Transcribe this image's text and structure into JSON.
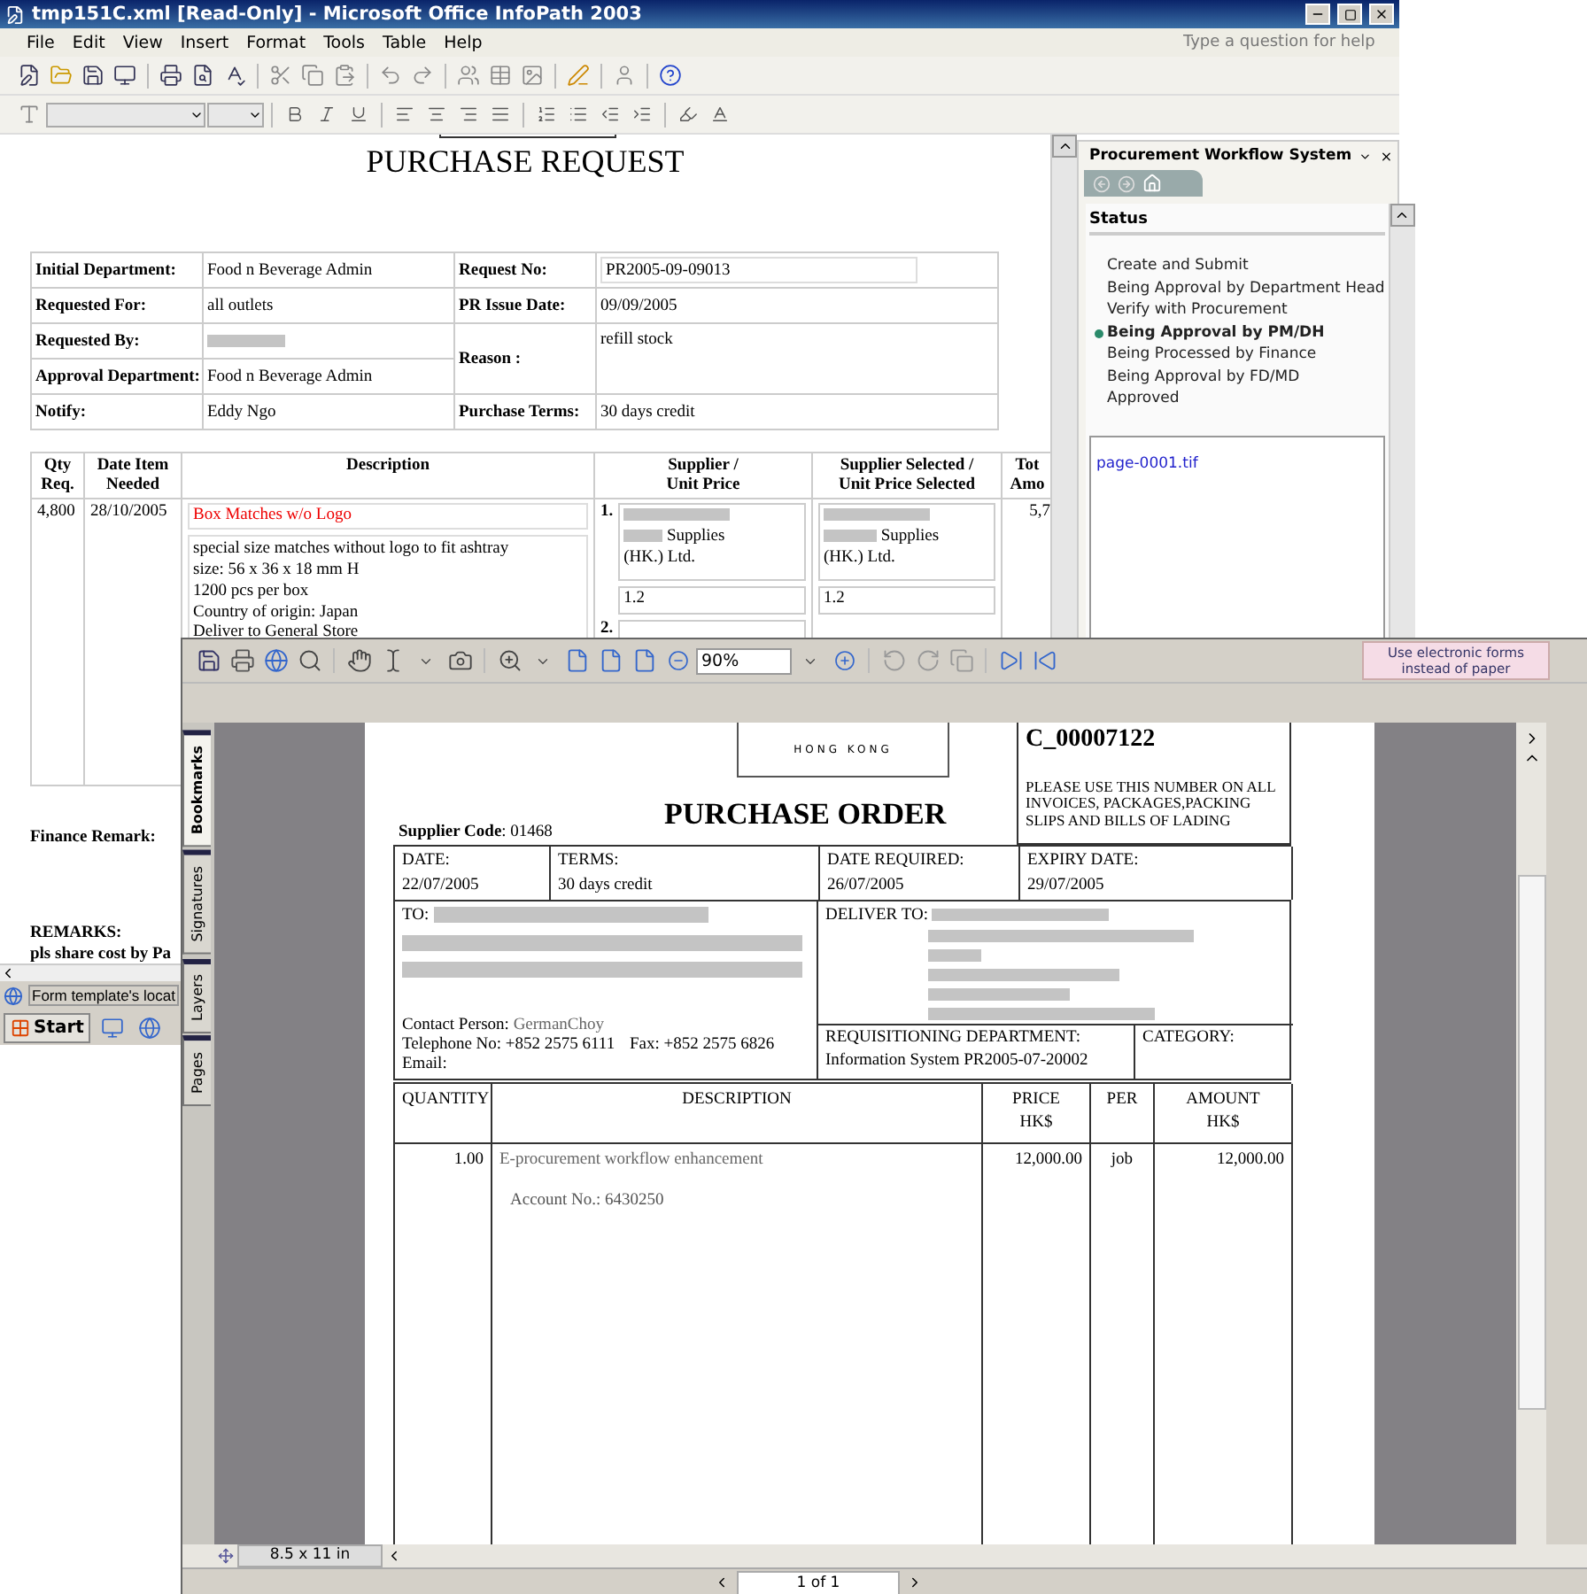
{
  "infopath": {
    "title": "tmp151C.xml [Read-Only] - Microsoft Office InfoPath 2003",
    "menu": [
      "File",
      "Edit",
      "View",
      "Insert",
      "Format",
      "Tools",
      "Table",
      "Help"
    ],
    "help_placeholder": "Type a question for help",
    "form": {
      "title": "PURCHASE REQUEST",
      "left_fields": [
        {
          "label": "Initial Department:",
          "value": "Food n Beverage Admin",
          "redacted": false
        },
        {
          "label": "Requested For:",
          "value": "all outlets",
          "redacted": false
        },
        {
          "label": "Requested By:",
          "redacted": true
        },
        {
          "label": "Approval Department:",
          "value": "Food n Beverage Admin",
          "redacted": false
        },
        {
          "label": "Notify:",
          "value": "Eddy Ngo",
          "redacted": false
        }
      ],
      "right_fields": [
        {
          "kind": "boxed",
          "label": "Request No:",
          "value": "PR2005-09-09013"
        },
        {
          "kind": "plain",
          "label": "PR Issue Date:",
          "value": "09/09/2005"
        },
        {
          "kind": "tall",
          "label": "Reason :",
          "value": "refill stock"
        },
        {
          "kind": "plain",
          "label": "Purchase Terms:",
          "value": "30 days credit"
        }
      ],
      "items_columns": [
        "Qty\nReq.",
        "Date Item\nNeeded",
        "Description",
        "Supplier  /\nUnit Price",
        "Supplier Selected /\nUnit Price Selected",
        "Tot\nAmo"
      ],
      "item": {
        "qty": "4,800",
        "date": "28/10/2005",
        "name": "Box Matches w/o Logo",
        "details": [
          "special size matches without logo to fit ashtray",
          "size: 56 x 36 x 18 mm H",
          "1200 pcs per box",
          "Country of origin: Japan",
          "Deliver to General Store"
        ],
        "suppliers": [
          {
            "number": "1.",
            "name_lines": [
              "Supplies",
              "(HK.) Ltd."
            ],
            "price": "1.2"
          },
          {
            "number": "2."
          }
        ],
        "selected": {
          "name_lines": [
            "Supplies",
            "(HK.) Ltd."
          ],
          "price": "1.2"
        },
        "total": "5,7"
      },
      "finance_remark_label": "Finance Remark:",
      "remarks_label": "REMARKS:",
      "remarks_text": "pls share cost by Pa"
    },
    "task_pane": {
      "title": "Procurement Workflow System",
      "section": "Status",
      "steps": [
        {
          "label": "Create and Submit",
          "selected": false
        },
        {
          "label": "Being Approval by Department Head",
          "selected": false
        },
        {
          "label": "Verify with Procurement",
          "selected": false
        },
        {
          "label": "Being Approval by PM/DH",
          "selected": true
        },
        {
          "label": "Being Processed by Finance",
          "selected": false
        },
        {
          "label": "Being Approval by FD/MD",
          "selected": false
        },
        {
          "label": "Approved",
          "selected": false
        }
      ],
      "attachment": "page-0001.tif"
    },
    "status_text": "Form template's locat"
  },
  "taskbar": {
    "start": "Start"
  },
  "viewer": {
    "zoom": "90%",
    "promo": "Use electronic forms instead of paper",
    "side_tabs": [
      {
        "label": "Bookmarks",
        "selected": true
      },
      {
        "label": "Signatures",
        "selected": false
      },
      {
        "label": "Layers",
        "selected": false
      },
      {
        "label": "Pages",
        "selected": false
      }
    ],
    "document": {
      "logo_text": "HONG KONG",
      "po_number": "C_00007122",
      "notice": "PLEASE USE THIS NUMBER ON ALL INVOICES, PACKAGES,PACKING SLIPS AND BILLS OF LADING",
      "title": "PURCHASE ORDER",
      "supplier_code": "**Supplier Code**: 01468",
      "terms": [
        {
          "label": "DATE:",
          "value": "22/07/2005"
        },
        {
          "label": "TERMS:",
          "value": "30 days credit"
        },
        {
          "label": "DATE REQUIRED:",
          "value": "26/07/2005"
        },
        {
          "label": "EXPIRY DATE:",
          "value": "29/07/2005"
        }
      ],
      "to_label": "TO:",
      "contact_label": "Contact Person:",
      "contact_name": "GermanChoy",
      "telephone": "Telephone No: +852 2575 6111",
      "fax": "Fax:  +852 2575 6826",
      "email_label": "Email:",
      "deliver_label": "DELIVER TO:",
      "requisition_label": "REQUISITIONING DEPARTMENT:",
      "requisition_value": "Information System  PR2005-07-20002",
      "category_label": "CATEGORY:",
      "line_columns": [
        "QUANTITY",
        "DESCRIPTION",
        "PRICE\nHK$",
        "PER",
        "AMOUNT\nHK$"
      ],
      "lines": [
        {
          "quantity": "1.00",
          "description": "E-procurement workflow enhancement",
          "note": "Account No.: 6430250",
          "price": "12,000.00",
          "per": "job",
          "amount": "12,000.00"
        }
      ]
    },
    "page_size": "8.5 x 11 in",
    "page_nav": "1 of 1"
  }
}
